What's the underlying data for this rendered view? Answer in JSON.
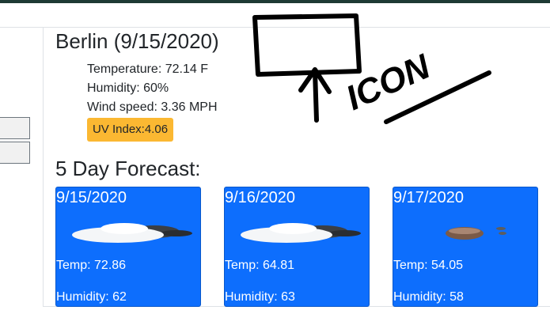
{
  "current": {
    "city_date": "Berlin (9/15/2020)",
    "temperature": "Temperature: 72.14 F",
    "humidity": "Humidity: 60%",
    "wind": "Wind speed: 3.36 MPH",
    "uv_index": "UV Index:4.06",
    "uv_color": "#fbb832"
  },
  "annotation": {
    "text": "ICON"
  },
  "forecast": {
    "title": "5 Day Forecast:",
    "card_color": "#0d6efd",
    "cards": [
      {
        "date": "9/15/2020",
        "icon": "cloudy-icon",
        "temp": "Temp: 72.86",
        "humidity": "Humidity: 62"
      },
      {
        "date": "9/16/2020",
        "icon": "cloudy-icon",
        "temp": "Temp: 64.81",
        "humidity": "Humidity: 63"
      },
      {
        "date": "9/17/2020",
        "icon": "rain-icon",
        "temp": "Temp: 54.05",
        "humidity": "Humidity: 58"
      }
    ]
  }
}
